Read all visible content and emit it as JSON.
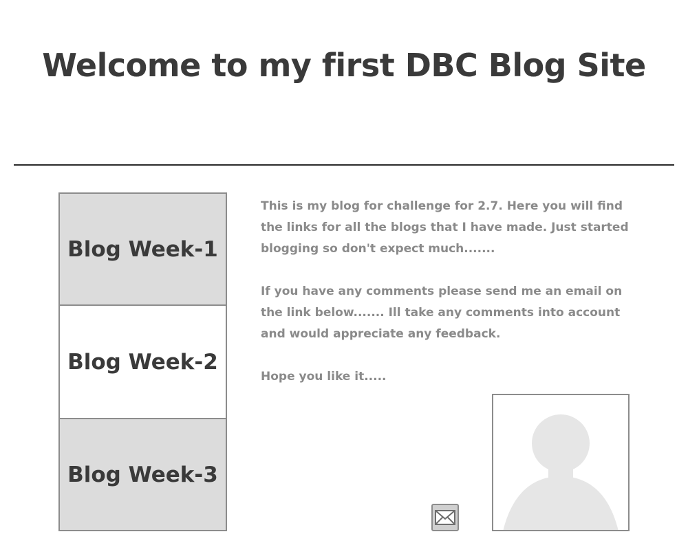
{
  "header": {
    "title": "Welcome to my first DBC Blog Site"
  },
  "nav": {
    "links": [
      {
        "label": "Blog Week-1"
      },
      {
        "label": "Blog Week-2"
      },
      {
        "label": "Blog Week-3"
      }
    ]
  },
  "intro": {
    "paragraphs": [
      "This is my blog for challenge for 2.7. Here you will find the links for all the blogs that I have made. Just started blogging so don't expect much.......",
      "If you have any comments please send me an email on the link below....... Ill take any comments into account and would appreciate any feedback.",
      "Hope you like it....."
    ]
  },
  "icons": {
    "mail": "envelope-icon",
    "avatar": "person-silhouette-icon"
  },
  "colors": {
    "title_text": "#3a3a3a",
    "body_text": "#8a8a8a",
    "nav_shaded_bg": "#dcdcdc",
    "border": "#8c8c8c",
    "divider": "#2a2a2a"
  }
}
